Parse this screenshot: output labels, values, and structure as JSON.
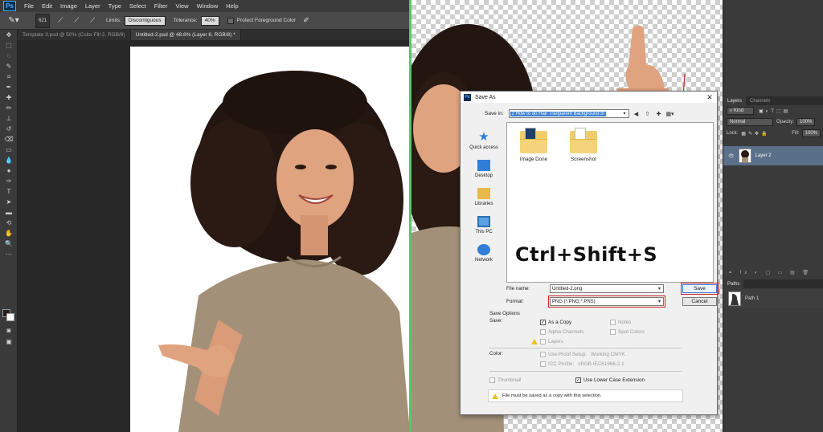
{
  "app": {
    "logo": "Ps"
  },
  "menubar": [
    "File",
    "Edit",
    "Image",
    "Layer",
    "Type",
    "Select",
    "Filter",
    "View",
    "Window",
    "Help"
  ],
  "options_bar": {
    "brush_size": "621",
    "limits_label": "Limits:",
    "limits_value": "Discontiguous",
    "tolerance_label": "Tolerance:",
    "tolerance_value": "40%",
    "protect_label": "Protect Foreground Color"
  },
  "tabs": [
    {
      "label": "Template 3.psd @ 50% (Color Fill 3, RGB/8)",
      "active": false
    },
    {
      "label": "Untitled-2.psd @ 48.8% (Layer 6, RGB/8) *",
      "active": true
    }
  ],
  "layers_panel": {
    "tabs": [
      "Layers",
      "Channels"
    ],
    "kind": "Kind",
    "blend_mode": "Normal",
    "opacity_label": "Opacity:",
    "opacity_value": "100%",
    "lock_label": "Lock:",
    "fill_label": "Fill:",
    "fill_value": "100%",
    "layer_name": "Layer 2"
  },
  "paths_panel": {
    "tab": "Paths",
    "path_name": "Path 1"
  },
  "save_dialog": {
    "title": "Save As",
    "save_in_label": "Save in:",
    "save_in_value": "2 How to do Hair Tranparent Background in",
    "places": [
      "Quick access",
      "Desktop",
      "Libraries",
      "This PC",
      "Network"
    ],
    "files": [
      "Image Done",
      "Screenshot"
    ],
    "overlay_text": "Ctrl+Shift+S",
    "file_name_label": "File name:",
    "file_name_value": "Untitled-2.png",
    "format_label": "Format:",
    "format_value": "PNG (*.PNG;*.PNS)",
    "save_button": "Save",
    "cancel_button": "Cancel",
    "save_options_title": "Save Options",
    "save_label": "Save:",
    "as_copy": "As a Copy",
    "notes": "Notes",
    "alpha_channels": "Alpha Channels",
    "spot_colors": "Spot Colors",
    "layers": "Layers",
    "color_label": "Color:",
    "use_proof": "Use Proof Setup:",
    "working_cmyk": "Working CMYK",
    "icc_profile": "ICC Profile:",
    "icc_value": "sRGB IEC61966-2.1",
    "thumbnail": "Thumbnail",
    "lower_case": "Use Lower Case Extension",
    "warning": "File must be saved as a copy with this selection."
  }
}
